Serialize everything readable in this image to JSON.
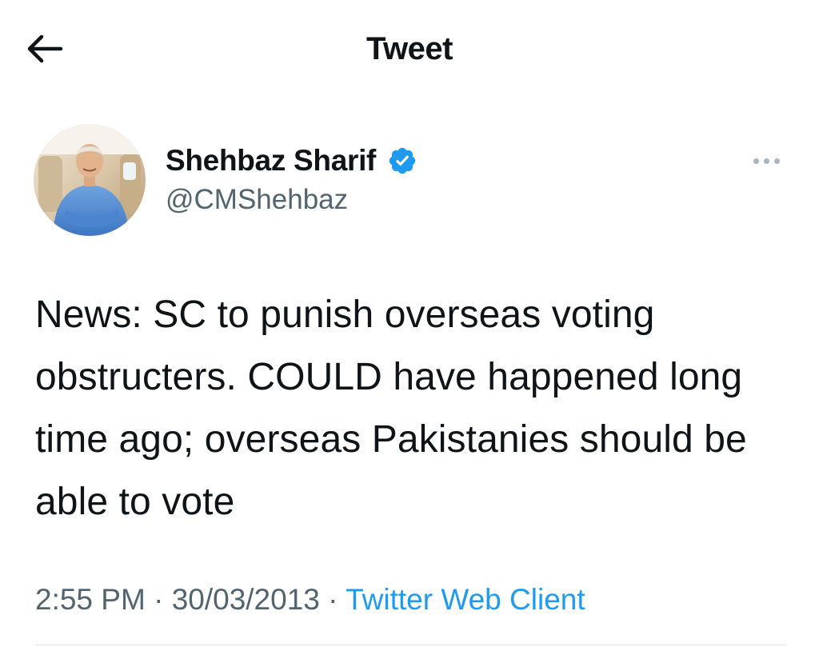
{
  "header": {
    "title": "Tweet",
    "back_icon": "arrow-left-icon"
  },
  "author": {
    "display_name": "Shehbaz Sharif",
    "handle": "@CMShehbaz",
    "verified_icon": "verified-badge-icon",
    "more_icon": "more-horizontal-icon"
  },
  "tweet": {
    "text": "News: SC to punish overseas voting obstructers. COULD have happened long time ago; overseas Pakistanies should be able to vote",
    "time": "2:55 PM",
    "separator": "·",
    "date": "30/03/2013",
    "source": "Twitter Web Client"
  },
  "colors": {
    "text": "#0f1419",
    "secondary": "#536471",
    "accent": "#1d9bf0",
    "divider": "#e6e9ec"
  }
}
